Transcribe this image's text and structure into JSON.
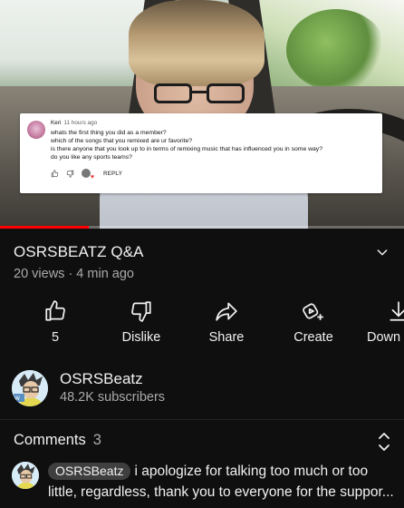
{
  "video": {
    "progress_fraction": 0.22,
    "overlay_comment": {
      "author": "Keri",
      "time": "11 hours ago",
      "lines": [
        "whats the first thing you did as a member?",
        "which of the songs that you remixed are ur favorite?",
        "is there anyone that you look up to in terms of remixing music that has influenced you in some way?",
        "do you like any sports teams?"
      ],
      "reply_label": "REPLY"
    }
  },
  "info": {
    "title": "OSRSBEATZ Q&A",
    "meta": "20 views · 4 min ago"
  },
  "actions": [
    {
      "label": "5",
      "icon": "thumbs-up-icon"
    },
    {
      "label": "Dislike",
      "icon": "thumbs-down-icon"
    },
    {
      "label": "Share",
      "icon": "share-icon"
    },
    {
      "label": "Create",
      "icon": "create-icon"
    },
    {
      "label": "Down",
      "icon": "download-icon"
    }
  ],
  "channel": {
    "name": "OSRSBeatz",
    "subscribers": "48.2K subscribers"
  },
  "comments": {
    "label": "Comments",
    "count": "3",
    "top": {
      "author": "OSRSBeatz",
      "line1": "i apologize for talking too much or too",
      "line2": "little, regardless, thank you to everyone for the suppor..."
    }
  },
  "colors": {
    "background": "#0f0f0f",
    "progress": "#ff0000",
    "secondary_text": "#aaaaaa"
  }
}
